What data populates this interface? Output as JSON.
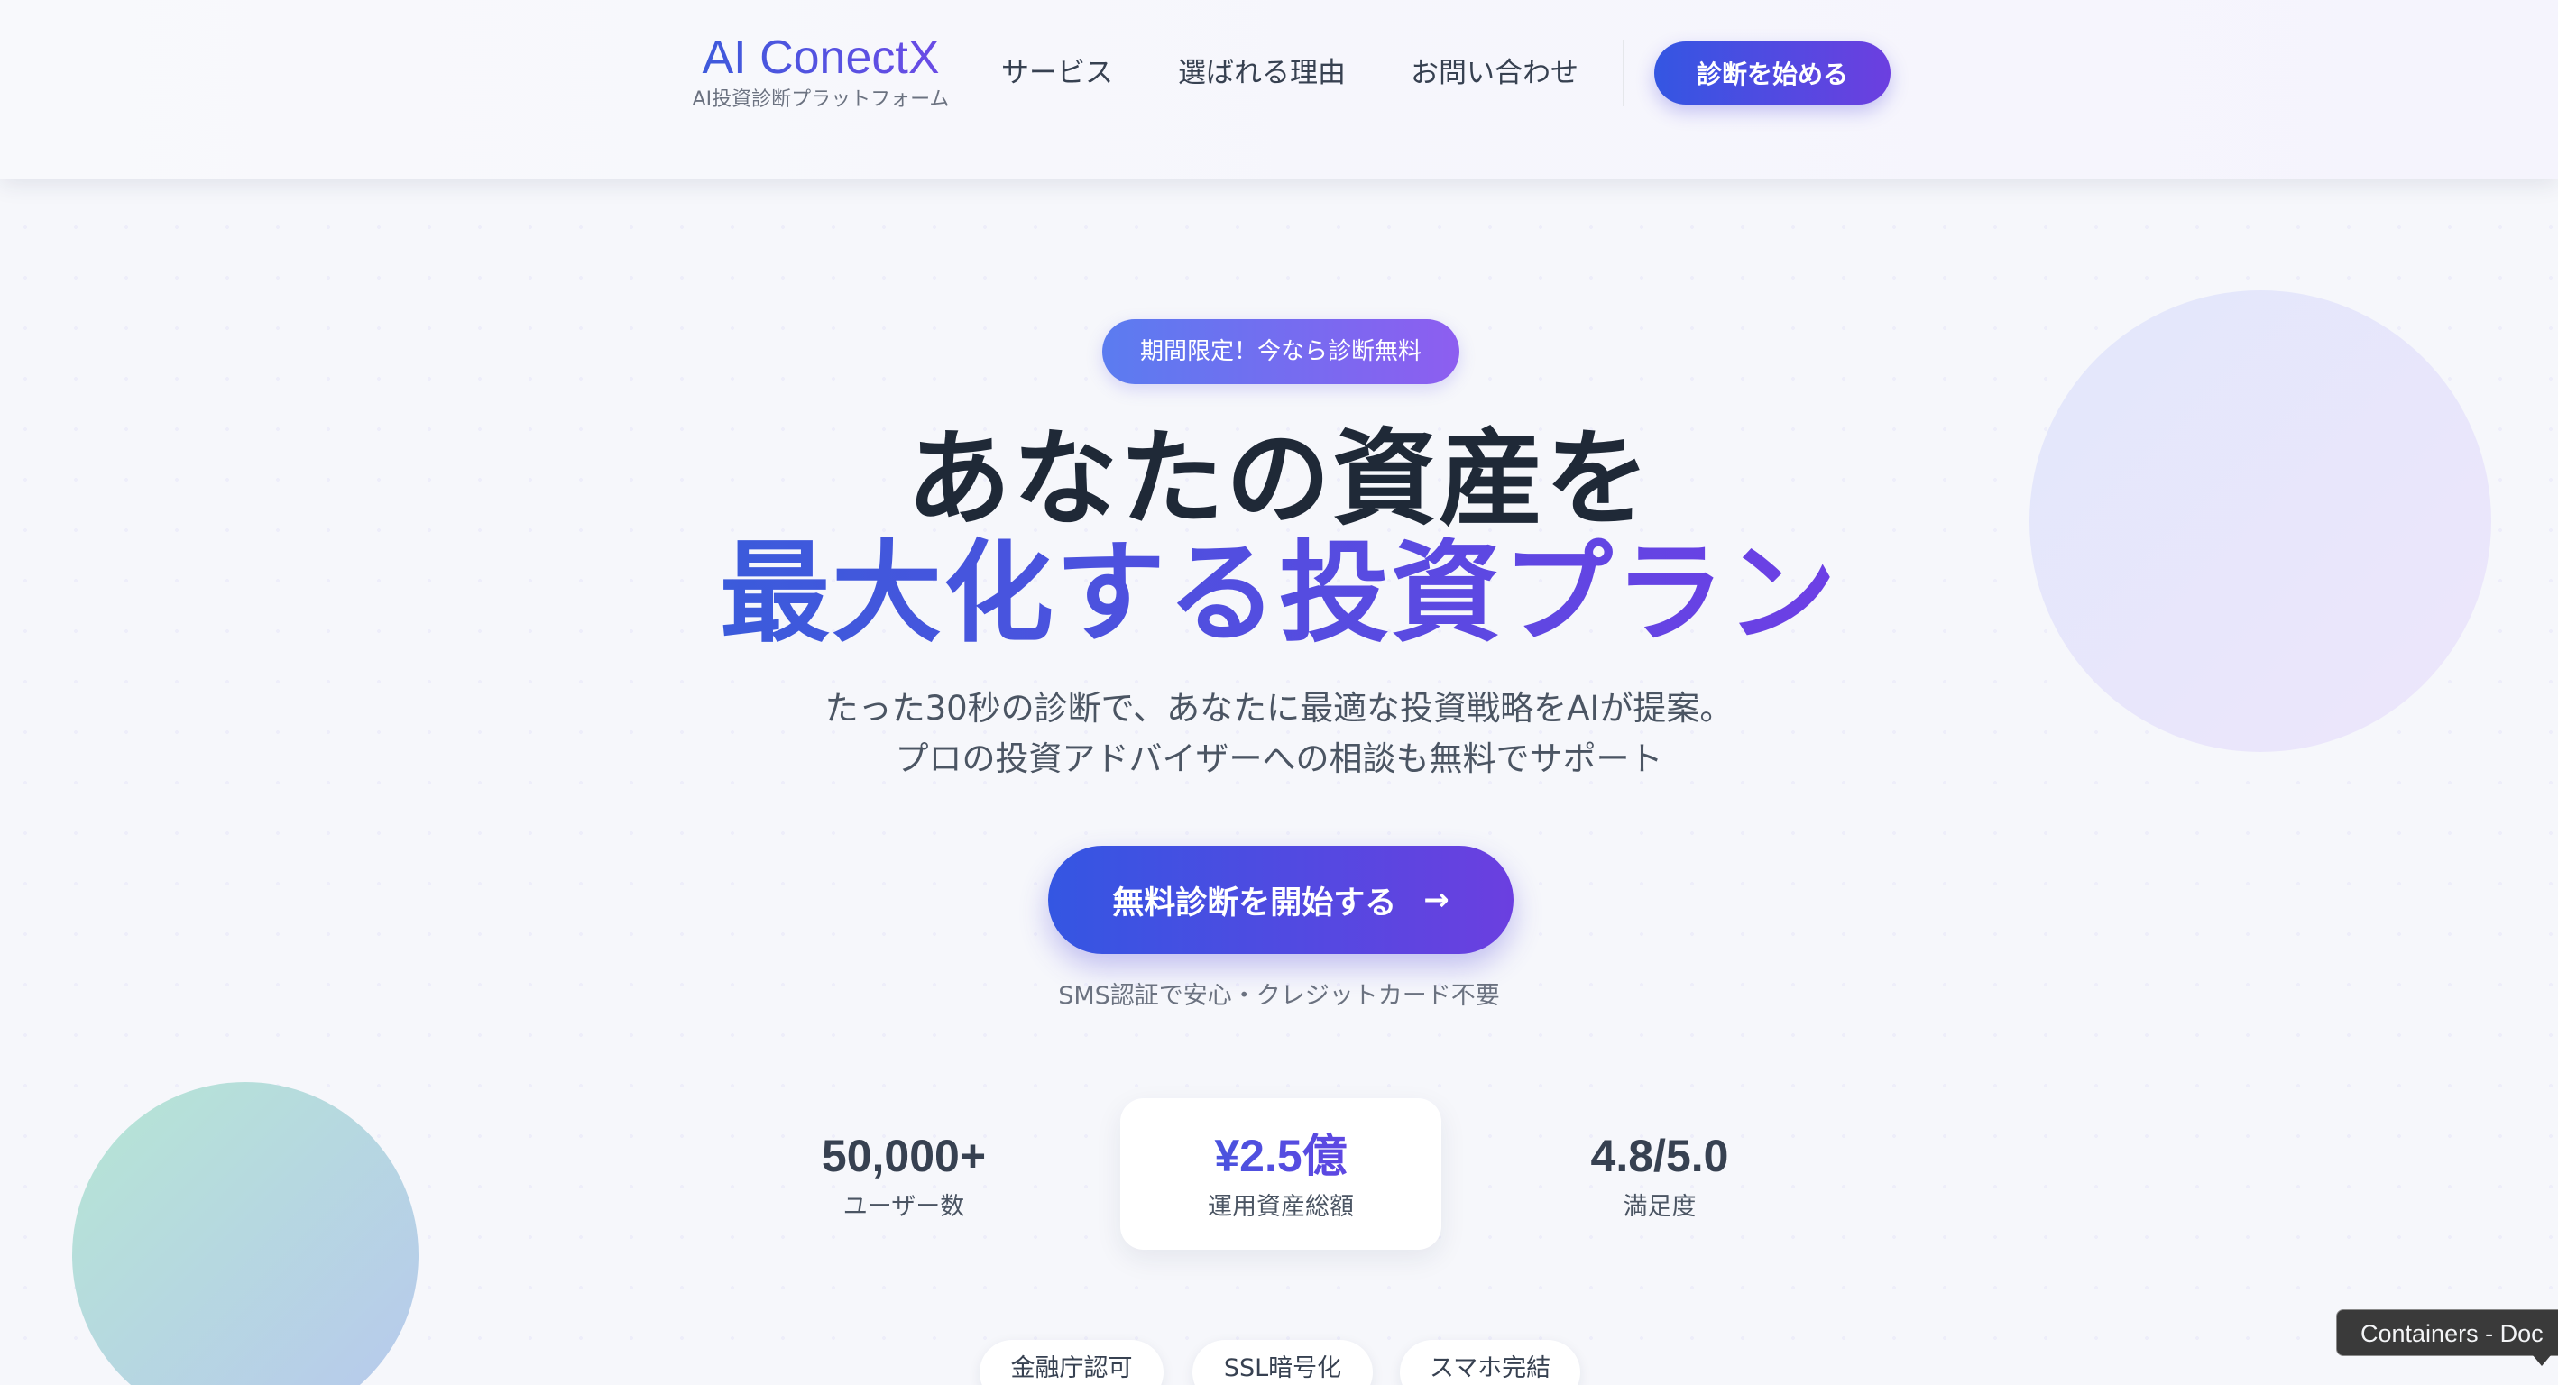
{
  "header": {
    "brand_name": "AI ConectX",
    "brand_tagline": "AI投資診断プラットフォーム",
    "nav": [
      "サービス",
      "選ばれる理由",
      "お問い合わせ"
    ],
    "cta": "診断を始める"
  },
  "hero": {
    "badge": "期間限定！今なら診断無料",
    "headline_line1": "あなたの資産を",
    "headline_line2": "最大化する投資プラン",
    "subtext_line1": "たった30秒の診断で、あなたに最適な投資戦略をAIが提案。",
    "subtext_line2": "プロの投資アドバイザーへの相談も無料でサポート",
    "cta": "無料診断を開始する",
    "cta_arrow": "→",
    "cta_note": "SMS認証で安心・クレジットカード不要"
  },
  "stats": [
    {
      "value": "50,000+",
      "label": "ユーザー数"
    },
    {
      "value": "¥2.5億",
      "label": "運用資産総額"
    },
    {
      "value": "4.8/5.0",
      "label": "満足度"
    }
  ],
  "trust_badges": [
    "金融庁認可",
    "SSL暗号化",
    "スマホ完結"
  ],
  "tooltip": "Containers - Doc",
  "colors": {
    "accent_start": "#3456e2",
    "accent_end": "#6b3fe0",
    "text_dark": "#1f2937",
    "background": "#f6f7fb"
  }
}
